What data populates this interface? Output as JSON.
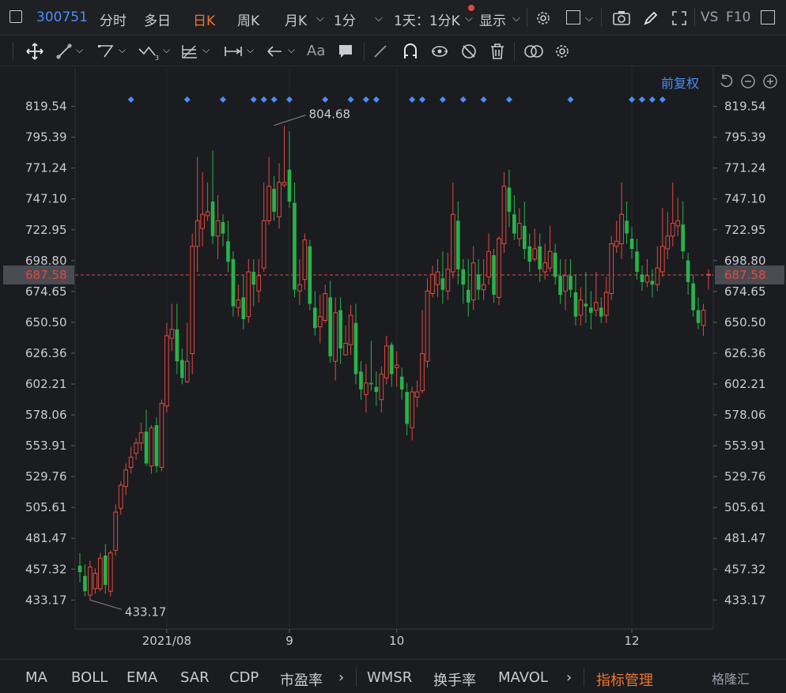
{
  "header": {
    "code": "300751",
    "tabs": [
      "分时",
      "多日",
      "日K",
      "周K",
      "月K",
      "1分"
    ],
    "active_tab": "日K",
    "period_label": "1天：1分K",
    "display_label": "显示",
    "vs_label": "VS",
    "f10_label": "F10"
  },
  "toolbar2_icons": [
    "move-icon",
    "line-icon",
    "polyline-icon",
    "wave-icon",
    "fib-icon",
    "range-icon",
    "arrow-icon",
    "text-aa-icon",
    "comment-icon",
    "pen-icon",
    "magnet-icon",
    "eye-icon",
    "hide-icon",
    "trash-icon",
    "layers-icon",
    "settings-icon"
  ],
  "text_aa": "Aa",
  "adjust_label": "前复权",
  "indicators": [
    "MA",
    "BOLL",
    "EMA",
    "SAR",
    "CDP",
    "市盈率",
    "WMSR",
    "换手率",
    "MAVOL",
    "指标管理"
  ],
  "active_indicator": "指标管理",
  "watermark": "格隆汇",
  "colors": {
    "up": "#e2493f",
    "down": "#27b34a",
    "accent": "#4c8df6",
    "active": "#f0752e",
    "current": "#e2493f"
  },
  "chart_data": {
    "type": "candlestick",
    "ylim": [
      420.0,
      830.0
    ],
    "y_ticks": [
      "819.54",
      "795.39",
      "771.24",
      "747.10",
      "722.95",
      "698.80",
      "674.65",
      "650.50",
      "626.36",
      "602.21",
      "578.06",
      "553.91",
      "529.76",
      "505.61",
      "481.47",
      "457.32",
      "433.17"
    ],
    "x_ticks": [
      {
        "index": 17,
        "label": "2021/08"
      },
      {
        "index": 41,
        "label": "9"
      },
      {
        "index": 62,
        "label": "10"
      },
      {
        "index": 108,
        "label": "12"
      }
    ],
    "current_price": "687.58",
    "max_label": "804.68",
    "min_label": "433.17",
    "max_index": 38,
    "min_index": 2,
    "marker_indices": [
      10,
      21,
      28,
      34,
      36,
      38,
      41,
      48,
      53,
      56,
      58,
      65,
      67,
      71,
      75,
      79,
      84,
      96,
      108,
      110,
      112,
      114
    ],
    "candles": [
      [
        460,
        455,
        470,
        447
      ],
      [
        452,
        440,
        461,
        436
      ],
      [
        437,
        459,
        464,
        433
      ],
      [
        442,
        454,
        458,
        438
      ],
      [
        442,
        466,
        470,
        440
      ],
      [
        468,
        445,
        477,
        438
      ],
      [
        440,
        470,
        472,
        436
      ],
      [
        472,
        502,
        508,
        468
      ],
      [
        505,
        523,
        526,
        500
      ],
      [
        522,
        535,
        540,
        515
      ],
      [
        537,
        545,
        553,
        532
      ],
      [
        548,
        556,
        560,
        543
      ],
      [
        556,
        564,
        572,
        550
      ],
      [
        565,
        540,
        582,
        538
      ],
      [
        538,
        568,
        570,
        532
      ],
      [
        570,
        538,
        576,
        533
      ],
      [
        537,
        587,
        590,
        534
      ],
      [
        585,
        640,
        650,
        580
      ],
      [
        638,
        645,
        665,
        628
      ],
      [
        645,
        620,
        665,
        610
      ],
      [
        621,
        607,
        630,
        602
      ],
      [
        604,
        620,
        650,
        603
      ],
      [
        626,
        710,
        720,
        610
      ],
      [
        710,
        730,
        780,
        690
      ],
      [
        724,
        735,
        768,
        710
      ],
      [
        734,
        737,
        760,
        730
      ],
      [
        745,
        718,
        785,
        712
      ],
      [
        718,
        730,
        750,
        700
      ],
      [
        729,
        720,
        735,
        710
      ],
      [
        714,
        698,
        730,
        690
      ],
      [
        700,
        663,
        706,
        655
      ],
      [
        662,
        668,
        680,
        655
      ],
      [
        670,
        653,
        688,
        645
      ],
      [
        655,
        690,
        700,
        650
      ],
      [
        690,
        680,
        700,
        663
      ],
      [
        675,
        687,
        700,
        666
      ],
      [
        693,
        730,
        760,
        690
      ],
      [
        730,
        757,
        780,
        727
      ],
      [
        755,
        737,
        765,
        730
      ],
      [
        733,
        760,
        775,
        724
      ],
      [
        758,
        760,
        804,
        756
      ],
      [
        770,
        745,
        800,
        740
      ],
      [
        744,
        676,
        760,
        670
      ],
      [
        675,
        680,
        700,
        664
      ],
      [
        684,
        715,
        720,
        676
      ],
      [
        710,
        665,
        715,
        660
      ],
      [
        662,
        646,
        675,
        640
      ],
      [
        647,
        655,
        672,
        634
      ],
      [
        652,
        673,
        680,
        650
      ],
      [
        670,
        624,
        683,
        619
      ],
      [
        620,
        658,
        670,
        605
      ],
      [
        660,
        630,
        670,
        618
      ],
      [
        625,
        634,
        648,
        625
      ],
      [
        633,
        656,
        664,
        625
      ],
      [
        650,
        610,
        665,
        602
      ],
      [
        612,
        598,
        620,
        590
      ],
      [
        594,
        603,
        618,
        580
      ],
      [
        603,
        602,
        636,
        597
      ],
      [
        600,
        596,
        612,
        585
      ],
      [
        590,
        610,
        616,
        580
      ],
      [
        607,
        632,
        640,
        602
      ],
      [
        633,
        610,
        635,
        600
      ],
      [
        615,
        617,
        628,
        600
      ],
      [
        608,
        598,
        615,
        590
      ],
      [
        596,
        571,
        603,
        562
      ],
      [
        568,
        596,
        600,
        558
      ],
      [
        592,
        596,
        605,
        584
      ],
      [
        597,
        626,
        660,
        595
      ],
      [
        620,
        675,
        685,
        615
      ],
      [
        673,
        688,
        695,
        670
      ],
      [
        680,
        690,
        700,
        670
      ],
      [
        685,
        676,
        706,
        665
      ],
      [
        675,
        692,
        705,
        668
      ],
      [
        690,
        735,
        760,
        685
      ],
      [
        730,
        692,
        745,
        680
      ],
      [
        692,
        680,
        700,
        665
      ],
      [
        676,
        666,
        700,
        655
      ],
      [
        668,
        697,
        710,
        660
      ],
      [
        688,
        676,
        700,
        668
      ],
      [
        676,
        680,
        700,
        668
      ],
      [
        686,
        706,
        720,
        680
      ],
      [
        703,
        672,
        708,
        666
      ],
      [
        670,
        716,
        718,
        664
      ],
      [
        712,
        757,
        768,
        705
      ],
      [
        756,
        737,
        770,
        725
      ],
      [
        735,
        720,
        750,
        715
      ],
      [
        716,
        728,
        740,
        710
      ],
      [
        726,
        708,
        745,
        700
      ],
      [
        710,
        698,
        720,
        690
      ],
      [
        700,
        708,
        724,
        698
      ],
      [
        710,
        692,
        720,
        682
      ],
      [
        690,
        697,
        712,
        684
      ],
      [
        693,
        706,
        726,
        690
      ],
      [
        705,
        686,
        712,
        680
      ],
      [
        687,
        672,
        700,
        665
      ],
      [
        675,
        687,
        700,
        660
      ],
      [
        687,
        676,
        700,
        670
      ],
      [
        674,
        655,
        688,
        648
      ],
      [
        656,
        668,
        678,
        648
      ],
      [
        665,
        663,
        690,
        650
      ],
      [
        662,
        658,
        675,
        645
      ],
      [
        660,
        666,
        690,
        655
      ],
      [
        662,
        655,
        670,
        650
      ],
      [
        656,
        674,
        686,
        650
      ],
      [
        673,
        712,
        718,
        668
      ],
      [
        710,
        714,
        730,
        705
      ],
      [
        712,
        735,
        760,
        700
      ],
      [
        730,
        720,
        745,
        712
      ],
      [
        716,
        708,
        725,
        700
      ],
      [
        706,
        690,
        716,
        684
      ],
      [
        688,
        682,
        695,
        675
      ],
      [
        682,
        687,
        700,
        678
      ],
      [
        683,
        680,
        692,
        670
      ],
      [
        680,
        693,
        710,
        675
      ],
      [
        690,
        710,
        740,
        686
      ],
      [
        708,
        718,
        737,
        700
      ],
      [
        718,
        728,
        760,
        710
      ],
      [
        726,
        730,
        748,
        718
      ],
      [
        727,
        706,
        745,
        700
      ],
      [
        699,
        682,
        705,
        672
      ],
      [
        681,
        660,
        688,
        655
      ],
      [
        660,
        650,
        670,
        645
      ],
      [
        648,
        660,
        665,
        640
      ],
      [
        688,
        688,
        692,
        676
      ]
    ]
  }
}
